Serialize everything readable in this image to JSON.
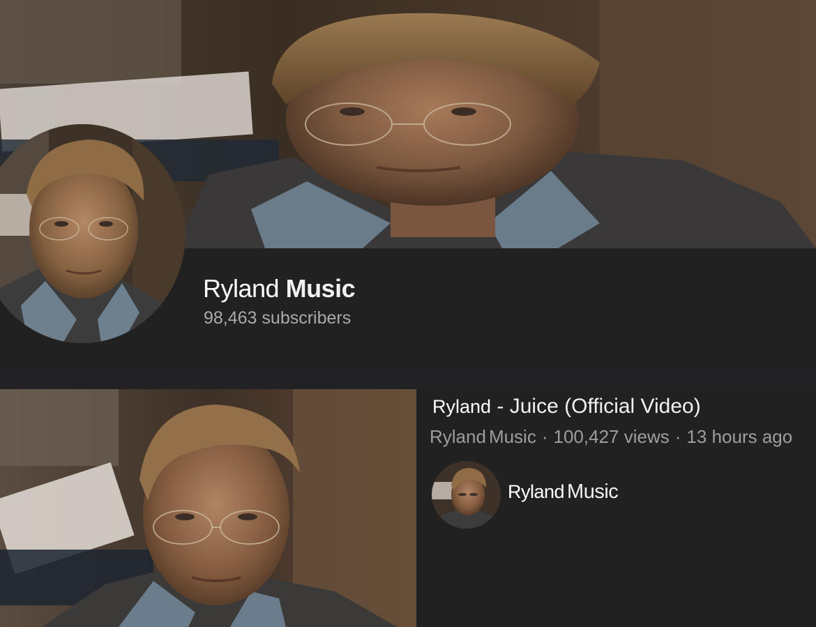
{
  "channel": {
    "name_first": "Ryland",
    "name_second": "Music",
    "subscribers": "98,463 subscribers"
  },
  "video": {
    "title_artist": "Ryland",
    "title_rest": "- Juice (Official Video)",
    "meta_channel_first": "Ryland",
    "meta_channel_second": "Music",
    "meta_separator": "·",
    "views": "100,427 views",
    "age": "13 hours ago"
  },
  "video_channel": {
    "name_first": "Ryland",
    "name_second": "Music"
  },
  "colors": {
    "background": "#212121",
    "text_primary": "#f1f1f1",
    "text_secondary": "#aaaaaa"
  }
}
